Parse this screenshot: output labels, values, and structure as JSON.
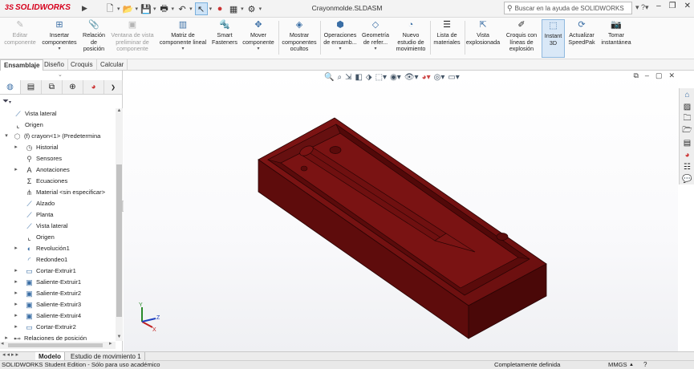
{
  "app": {
    "brand": "SOLIDWORKS",
    "brand_mark": "3S",
    "document_title": "Crayonmolde.SLDASM",
    "help_search_placeholder": "Buscar en la ayuda de SOLIDWORKS",
    "accent": "#d6001c"
  },
  "ribbon": {
    "buttons": [
      {
        "label": "Editar componente",
        "icon": "edit-component-icon",
        "disabled": true
      },
      {
        "label": "Insertar componentes",
        "icon": "insert-components-icon",
        "disabled": false
      },
      {
        "label": "Relación de posición",
        "icon": "mate-paperclip-icon",
        "disabled": false
      },
      {
        "label": "Ventana de vista preliminar de componente",
        "icon": "component-preview-icon",
        "disabled": true
      },
      {
        "label": "Matriz de componente lineal",
        "icon": "linear-pattern-icon",
        "disabled": false
      },
      {
        "label": "Smart Fasteners",
        "icon": "smart-fasteners-icon",
        "disabled": false
      },
      {
        "label": "Mover componente",
        "icon": "move-component-icon",
        "disabled": false
      },
      {
        "label": "Mostrar componentes ocultos",
        "icon": "show-hidden-icon",
        "disabled": false
      },
      {
        "label": "Operaciones de ensamb...",
        "icon": "assembly-features-icon",
        "disabled": false
      },
      {
        "label": "Geometría de refer...",
        "icon": "reference-geometry-icon",
        "disabled": false
      },
      {
        "label": "Nuevo estudio de movimiento",
        "icon": "new-motion-study-icon",
        "disabled": false
      },
      {
        "label": "Lista de materiales",
        "icon": "bill-of-materials-icon",
        "disabled": false
      },
      {
        "label": "Vista explosionada",
        "icon": "exploded-view-icon",
        "disabled": false
      },
      {
        "label": "Croquis con líneas de explosión",
        "icon": "explode-line-sketch-icon",
        "disabled": false
      },
      {
        "label": "Instant 3D",
        "icon": "instant-3d-icon",
        "disabled": false,
        "active": true
      },
      {
        "label": "Actualizar SpeedPak",
        "icon": "speedpak-icon",
        "disabled": false
      },
      {
        "label": "Tomar instantánea",
        "icon": "camera-icon",
        "disabled": false
      }
    ]
  },
  "command_tabs": [
    "Ensamblaje",
    "Diseño",
    "Croquis",
    "Calcular"
  ],
  "feature_tree": {
    "rows": [
      {
        "label": "Vista lateral",
        "icon": "plane-icon",
        "indent": 1,
        "expander": ""
      },
      {
        "label": "Origen",
        "icon": "origin-icon",
        "indent": 1,
        "expander": ""
      },
      {
        "label": "(f) crayon<1> (Predetermina",
        "icon": "part-icon",
        "indent": 0,
        "expander": "▾"
      },
      {
        "label": "Historial",
        "icon": "history-icon",
        "indent": 2,
        "expander": "▸"
      },
      {
        "label": "Sensores",
        "icon": "sensors-icon",
        "indent": 2,
        "expander": ""
      },
      {
        "label": "Anotaciones",
        "icon": "annotations-icon",
        "indent": 2,
        "expander": "▸"
      },
      {
        "label": "Ecuaciones",
        "icon": "equations-icon",
        "indent": 2,
        "expander": ""
      },
      {
        "label": "Material <sin especificar>",
        "icon": "material-icon",
        "indent": 2,
        "expander": ""
      },
      {
        "label": "Alzado",
        "icon": "plane-icon",
        "indent": 2,
        "expander": ""
      },
      {
        "label": "Planta",
        "icon": "plane-icon",
        "indent": 2,
        "expander": ""
      },
      {
        "label": "Vista lateral",
        "icon": "plane-icon",
        "indent": 2,
        "expander": ""
      },
      {
        "label": "Origen",
        "icon": "origin-icon",
        "indent": 2,
        "expander": ""
      },
      {
        "label": "Revolución1",
        "icon": "revolve-icon",
        "indent": 2,
        "expander": "▸"
      },
      {
        "label": "Redondeo1",
        "icon": "fillet-icon",
        "indent": 2,
        "expander": ""
      },
      {
        "label": "Cortar-Extruir1",
        "icon": "cut-extrude-icon",
        "indent": 2,
        "expander": "▸"
      },
      {
        "label": "Saliente-Extruir1",
        "icon": "boss-extrude-icon",
        "indent": 2,
        "expander": "▸"
      },
      {
        "label": "Saliente-Extruir2",
        "icon": "boss-extrude-icon",
        "indent": 2,
        "expander": "▸"
      },
      {
        "label": "Saliente-Extruir3",
        "icon": "boss-extrude-icon",
        "indent": 2,
        "expander": "▸"
      },
      {
        "label": "Saliente-Extruir4",
        "icon": "boss-extrude-icon",
        "indent": 2,
        "expander": "▸"
      },
      {
        "label": "Cortar-Extruir2",
        "icon": "cut-extrude-icon",
        "indent": 2,
        "expander": "▸"
      },
      {
        "label": "Relaciones de posición",
        "icon": "mates-icon",
        "indent": 0,
        "expander": "▸"
      }
    ]
  },
  "triad": {
    "x": "X",
    "y": "Y",
    "z": "Z"
  },
  "model": {
    "color": "#6b0e0e",
    "top_color": "#7a1212",
    "side_color": "#4c0808"
  },
  "bottom_tabs": [
    "Modelo",
    "Estudio de movimiento 1"
  ],
  "status": {
    "left": "SOLIDWORKS Student Edition - Sólo para uso académico",
    "definition": "Completamente definida",
    "units": "MMGS"
  }
}
